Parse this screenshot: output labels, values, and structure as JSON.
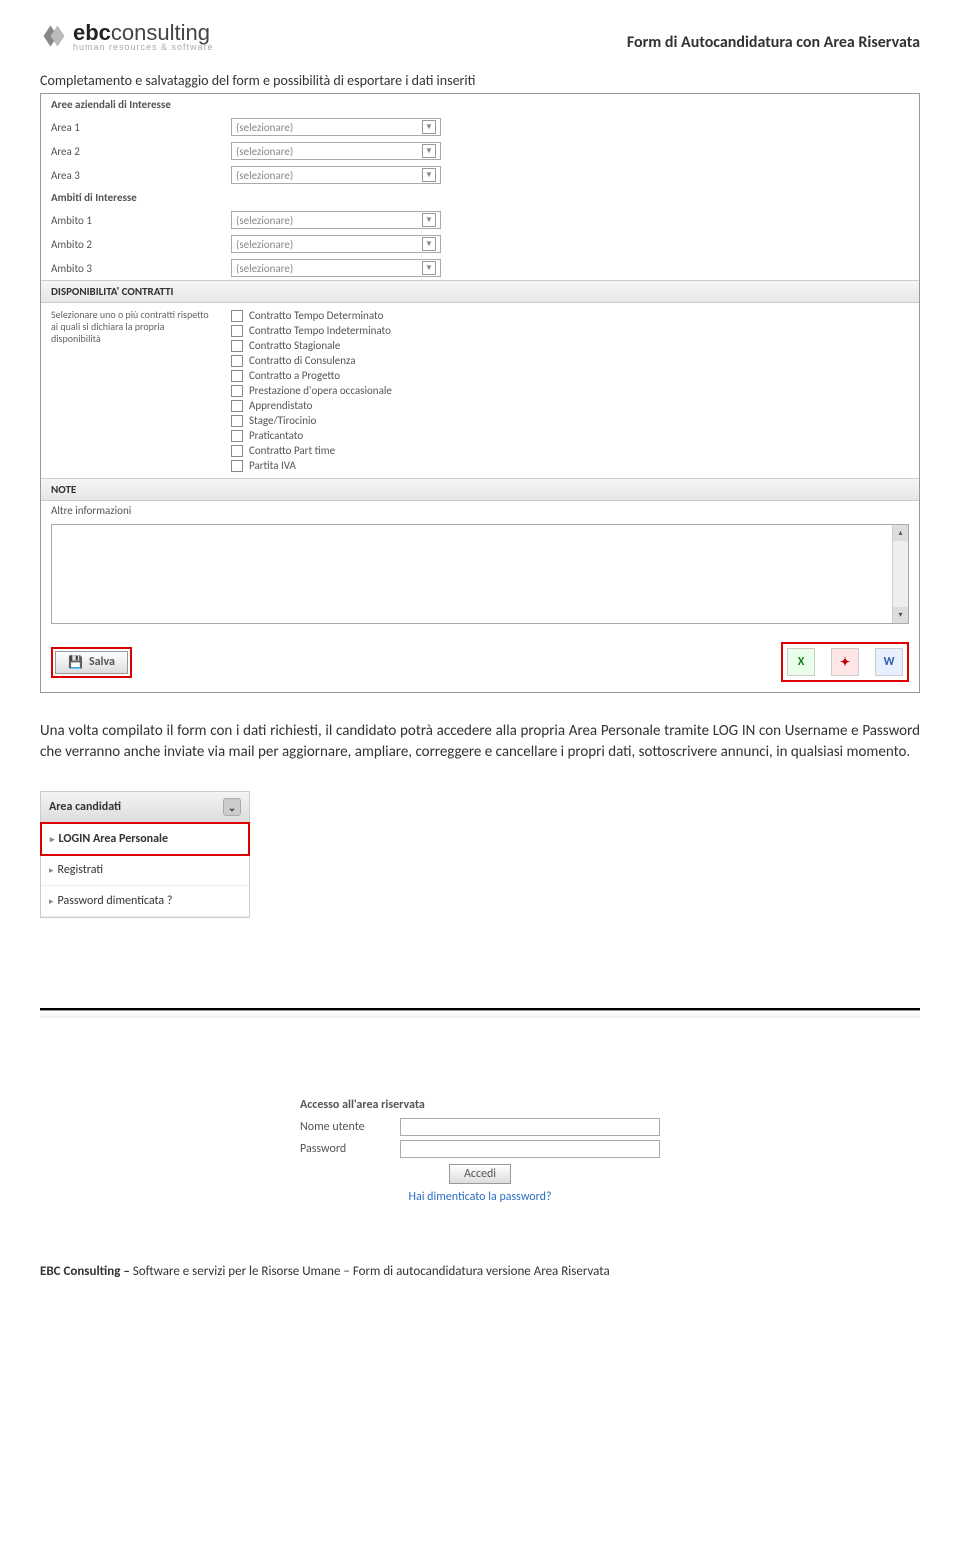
{
  "header": {
    "logo_main_bold": "ebc",
    "logo_main_rest": "consulting",
    "logo_sub": "human resources & software",
    "title": "Form di Autocandidatura con Area Riservata"
  },
  "intro": "Completamento e salvataggio del form e possibilità di esportare i dati inseriti",
  "form": {
    "sec_aree": "Aree aziendali di Interesse",
    "area1": "Area 1",
    "area2": "Area 2",
    "area3": "Area 3",
    "sec_ambiti": "Ambiti di Interesse",
    "ambito1": "Ambito 1",
    "ambito2": "Ambito 2",
    "ambito3": "Ambito 3",
    "select_placeholder": "(selezionare)",
    "sec_contratti": "DISPONIBILITA' CONTRATTI",
    "contratti_help": "Selezionare uno o più contratti rispetto ai quali si dichiara la propria disponibilità",
    "contratti": [
      "Contratto Tempo Determinato",
      "Contratto Tempo Indeterminato",
      "Contratto Stagionale",
      "Contratto di Consulenza",
      "Contratto a Progetto",
      "Prestazione d'opera occasionale",
      "Apprendistato",
      "Stage/Tirocinio",
      "Praticantato",
      "Contratto Part time",
      "Partita IVA"
    ],
    "sec_note": "NOTE",
    "note_label": "Altre informazioni",
    "salva": "Salva"
  },
  "paragraph": "Una volta compilato il form con i dati richiesti, il candidato potrà accedere alla propria Area Personale tramite LOG IN con  Username e Password che verranno anche inviate via mail per aggiornare, ampliare, correggere e cancellare i propri dati, sottoscrivere annunci, in qualsiasi momento.",
  "sidebar": {
    "head": "Area candidati",
    "items": [
      "LOGIN Area Personale",
      "Registrati",
      "Password dimenticata ?"
    ]
  },
  "login": {
    "title": "Accesso all'area riservata",
    "user_label": "Nome utente",
    "pass_label": "Password",
    "button": "Accedi",
    "forgot": "Hai dimenticato la password?"
  },
  "footer": {
    "bold": "EBC Consulting – ",
    "rest": "Software e servizi per le Risorse Umane – Form di autocandidatura versione Area Riservata"
  }
}
